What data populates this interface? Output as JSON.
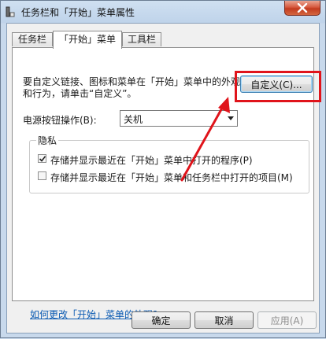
{
  "window": {
    "title": "任务栏和「开始」菜单属性"
  },
  "tabs": [
    {
      "label": "任务栏",
      "active": false
    },
    {
      "label": "「开始」菜单",
      "active": true
    },
    {
      "label": "工具栏",
      "active": false
    }
  ],
  "start_menu": {
    "description": "要自定义链接、图标和菜单在「开始」菜单中的外观和行为，请单击“自定义”。",
    "customize_button": "自定义(C)...",
    "power_label": "电源按钮操作(B):",
    "power_value": "关机",
    "privacy": {
      "title": "隐私",
      "items": [
        {
          "label": "存储并显示最近在「开始」菜单中打开的程序(P)",
          "checked": true
        },
        {
          "label": "存储并显示最近在「开始」菜单和任务栏中打开的项目(M)",
          "checked": false
        }
      ]
    },
    "help_link": "如何更改「开始」菜单的外观?"
  },
  "footer": {
    "ok": "确定",
    "cancel": "取消",
    "apply": "应用(A)"
  },
  "colors": {
    "highlight": "#e0141b",
    "link": "#0a5ab2"
  }
}
